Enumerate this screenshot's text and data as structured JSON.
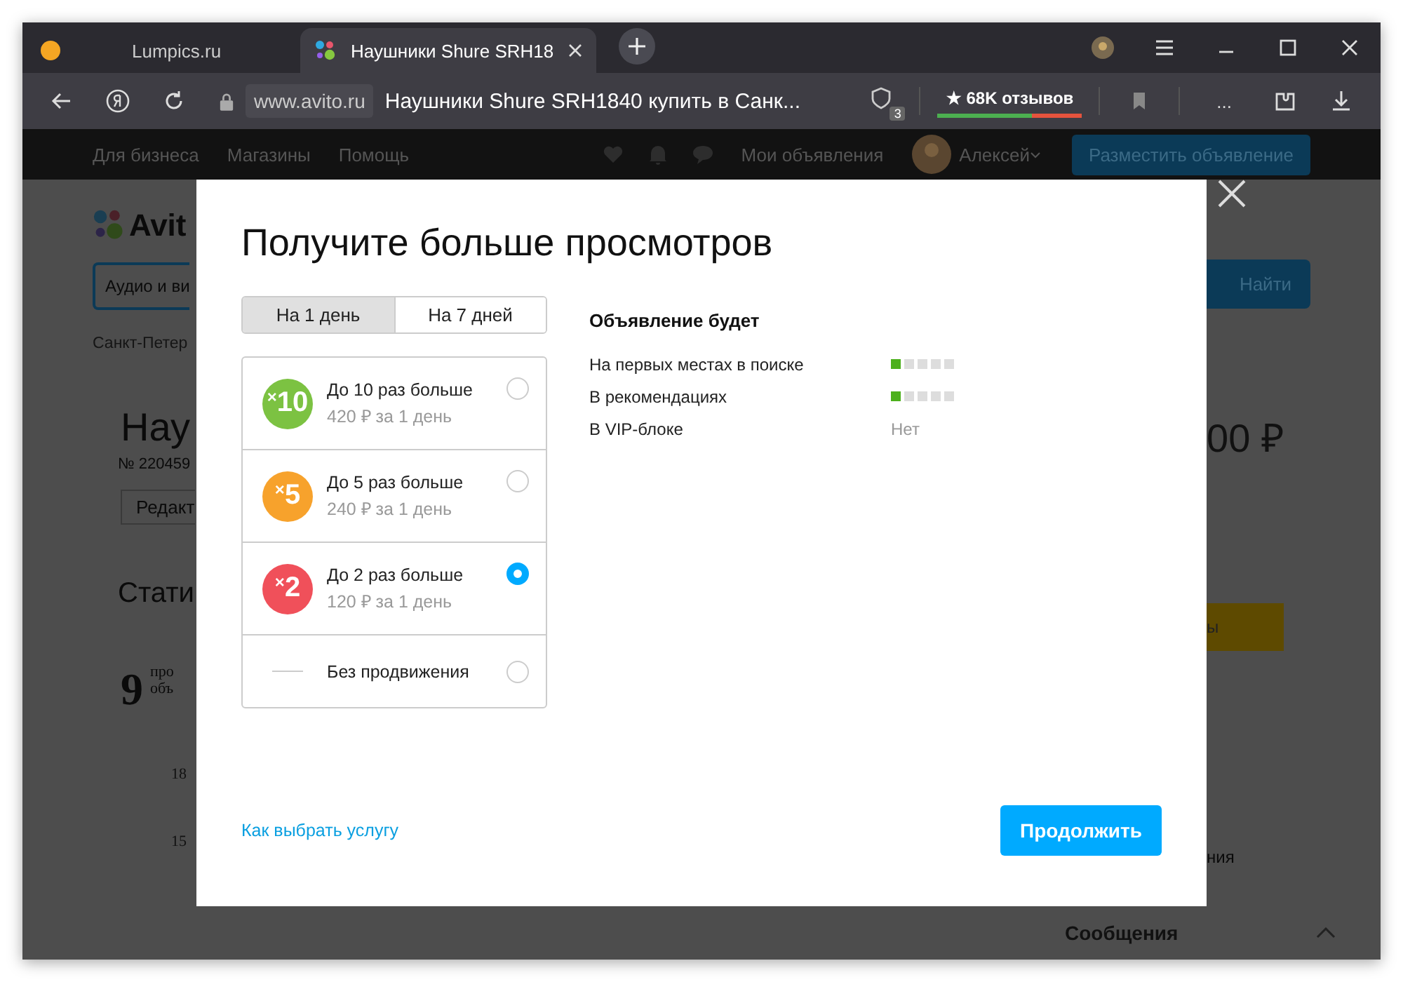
{
  "browser": {
    "tabs": [
      {
        "title": "Lumpics.ru",
        "selected": false,
        "kind": "orange"
      },
      {
        "title": "Наушники Shure SRH18",
        "selected": true,
        "kind": "avito"
      }
    ],
    "address": {
      "domain": "www.avito.ru",
      "title": "Наушники Shure SRH1840 купить в Санк..."
    },
    "shield_count": "3",
    "reviews": "★ 68K отзывов",
    "more": "..."
  },
  "site_header": {
    "links": [
      "Для бизнеса",
      "Магазины",
      "Помощь"
    ],
    "my_ads": "Мои объявления",
    "user": "Алексей",
    "post_button": "Разместить объявление"
  },
  "background": {
    "logo": "Avit",
    "search": "Аудио и ви",
    "city": "Санкт-Петер",
    "title": "Нау",
    "number": "№ 220459",
    "edit": "Редакт",
    "stats": "Стати",
    "views": "9",
    "views_note": [
      "про",
      "объ"
    ],
    "axis": [
      "18",
      "15"
    ],
    "find": "Найти",
    "price": "00 ₽",
    "promo": "ы",
    "note": "ния",
    "messages": "Сообщения"
  },
  "modal": {
    "title": "Получите больше просмотров",
    "periods": [
      {
        "label": "На 1 день",
        "selected": true
      },
      {
        "label": "На 7 дней",
        "selected": false
      }
    ],
    "options": [
      {
        "kind": "boost",
        "sign": "×",
        "factor": "10",
        "title": "До 10 раз больше",
        "price": "420 ₽ за 1 день",
        "color": "#7cc242",
        "selected": false
      },
      {
        "kind": "boost",
        "sign": "×",
        "factor": "5",
        "title": "До 5 раз больше",
        "price": "240 ₽ за 1 день",
        "color": "#f7a22c",
        "selected": false
      },
      {
        "kind": "boost",
        "sign": "×",
        "factor": "2",
        "title": "До 2 раз больше",
        "price": "120 ₽ за 1 день",
        "color": "#f0505a",
        "selected": true
      },
      {
        "kind": "none",
        "title": "Без продвижения",
        "selected": false
      }
    ],
    "info": {
      "heading": "Объявление будет",
      "rows": [
        {
          "kind": "meter",
          "label": "На первых местах в поиске",
          "level": 0.2
        },
        {
          "kind": "meter",
          "label": "В рекомендациях",
          "level": 0.2
        },
        {
          "kind": "text",
          "label": "В VIP-блоке",
          "value": "Нет"
        }
      ]
    },
    "help_link": "Как выбрать услугу",
    "continue": "Продолжить"
  }
}
